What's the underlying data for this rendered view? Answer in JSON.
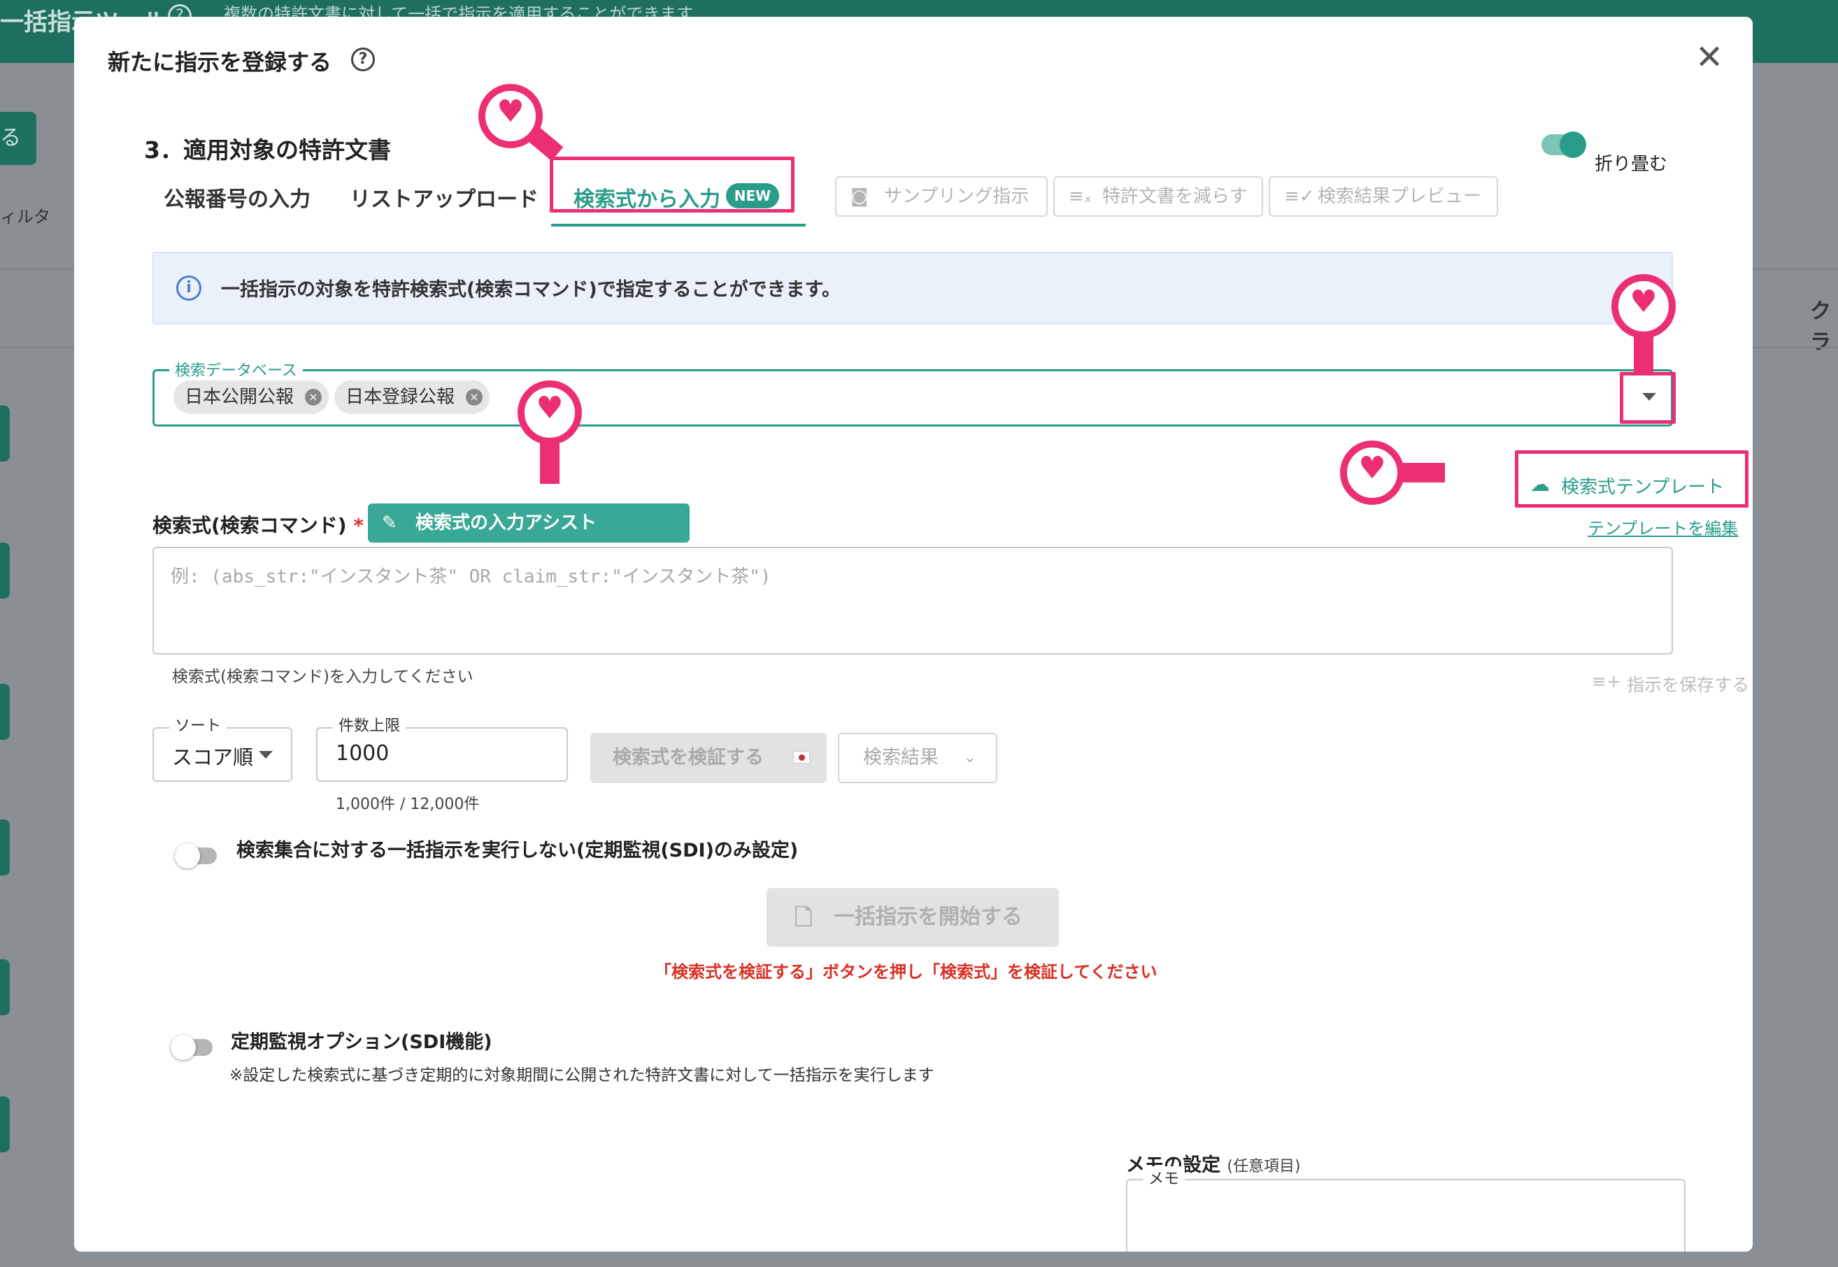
{
  "background": {
    "app_title": "一括指示ツール",
    "app_subtitle": "複数の特許文書に対して一括で指示を適用することができます",
    "side_button": "る",
    "filter_label": "ィルタ",
    "column_header": "クラ"
  },
  "modal": {
    "title": "新たに指示を登録する",
    "help_icon": "question-circle-icon",
    "close_icon": "close-icon",
    "section_title": "3．適用対象の特許文書",
    "collapse_label": "折り畳む",
    "collapse_on": true,
    "tabs": [
      {
        "label": "公報番号の入力"
      },
      {
        "label": "リストアップロード"
      },
      {
        "label": "検索式から入力",
        "badge": "NEW",
        "active": true
      }
    ],
    "tools": [
      {
        "label": "サンプリング指示",
        "icon": "eye-icon"
      },
      {
        "label": "特許文書を減らす",
        "icon": "list-remove-icon"
      },
      {
        "label": "検索結果プレビュー",
        "icon": "list-check-icon"
      }
    ],
    "info_text": "一括指示の対象を特許検索式(検索コマンド)で指定することができます。",
    "database": {
      "legend": "検索データベース",
      "chips": [
        "日本公開公報",
        "日本登録公報"
      ]
    },
    "template_link": "検索式テンプレート",
    "template_edit_link": "テンプレートを編集",
    "query": {
      "label": "検索式(検索コマンド)",
      "required_mark": "*",
      "assist_button": "検索式の入力アシスト",
      "placeholder": "例: (abs_str:\"インスタント茶\" OR claim_str:\"インスタント茶\")",
      "helper": "検索式(検索コマンド)を入力してください"
    },
    "save_instruction": "指示を保存する",
    "sort": {
      "legend": "ソート",
      "value": "スコア順"
    },
    "limit": {
      "legend": "件数上限",
      "value": "1000",
      "helper": "1,000件 / 12,000件"
    },
    "verify_button": "検索式を検証する",
    "results_button": "検索結果",
    "no_bulk_option": {
      "label": "検索集合に対する一括指示を実行しない(定期監視(SDI)のみ設定)",
      "on": false
    },
    "start_button": "一括指示を開始する",
    "error_text": "「検索式を検証する」ボタンを押し「検索式」を検証してください",
    "sdi_option": {
      "label": "定期監視オプション(SDI機能)",
      "note": "※設定した検索式に基づき定期的に対象期間に公開された特許文書に対して一括指示を実行します",
      "on": false
    },
    "memo": {
      "title": "メモの設定",
      "optional": "(任意項目)",
      "legend": "メモ"
    }
  },
  "colors": {
    "accent": "#2a9d8a",
    "highlight": "#ec2e74",
    "error": "#d93025"
  }
}
